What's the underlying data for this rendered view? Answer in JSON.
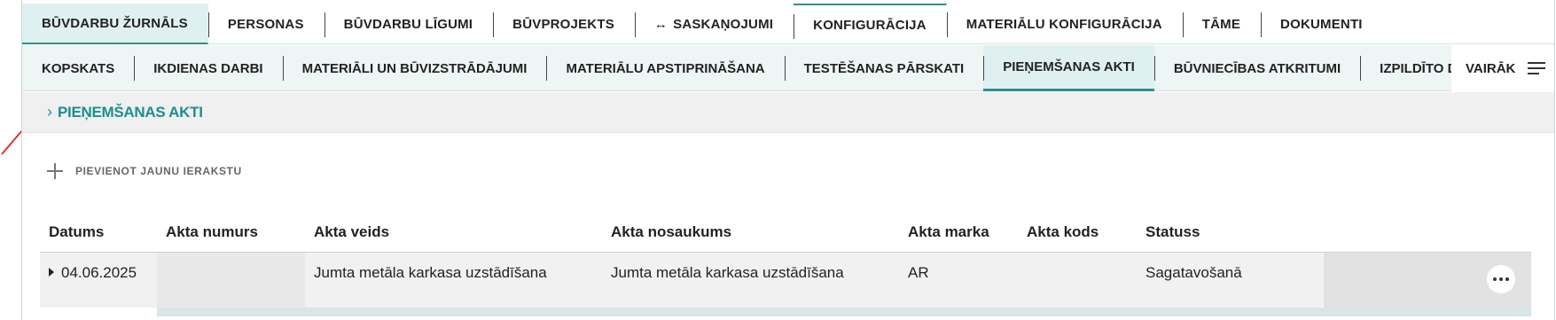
{
  "top_tabs": [
    {
      "label": "BŪVDARBU ŽURNĀLS",
      "active": true
    },
    {
      "label": "PERSONAS"
    },
    {
      "label": "BŪVDARBU LĪGUMI"
    },
    {
      "label": "BŪVPROJEKTS"
    },
    {
      "label": "SASKAŅOJUMI",
      "icon": "swap-arrows-icon"
    },
    {
      "label": "KONFIGURĀCIJA"
    },
    {
      "label": "MATERIĀLU KONFIGURĀCIJA"
    },
    {
      "label": "TĀME"
    },
    {
      "label": "DOKUMENTI"
    }
  ],
  "sub_tabs": [
    {
      "label": "KOPSKATS"
    },
    {
      "label": "IKDIENAS DARBI"
    },
    {
      "label": "MATERIĀLI UN BŪVIZSTRĀDĀJUMI"
    },
    {
      "label": "MATERIĀLU APSTIPRINĀŠANA"
    },
    {
      "label": "TESTĒŠANAS PĀRSKATI"
    },
    {
      "label": "PIEŅEMŠANAS AKTI",
      "active": true
    },
    {
      "label": "BŪVNIECĪBAS ATKRITUMI"
    },
    {
      "label": "IZPILDĪTO DARBU AKTI"
    }
  ],
  "more_label": "VAIRĀK",
  "breadcrumb": {
    "label": "PIEŅEMŠANAS AKTI"
  },
  "add_button": {
    "label": "PIEVIENOT JAUNU IERAKSTU"
  },
  "table": {
    "headers": [
      "Datums",
      "Akta numurs",
      "Akta veids",
      "Akta nosaukums",
      "Akta marka",
      "Akta kods",
      "Statuss"
    ],
    "rows": [
      [
        "04.06.2025",
        "",
        "Jumta metāla karkasa uzstādīšana",
        "Jumta metāla karkasa uzstādīšana",
        "AR",
        "",
        "Sagatavošanā"
      ]
    ]
  },
  "colors": {
    "accent": "#2e8f8f",
    "annotation_arrow": "#e03030"
  }
}
